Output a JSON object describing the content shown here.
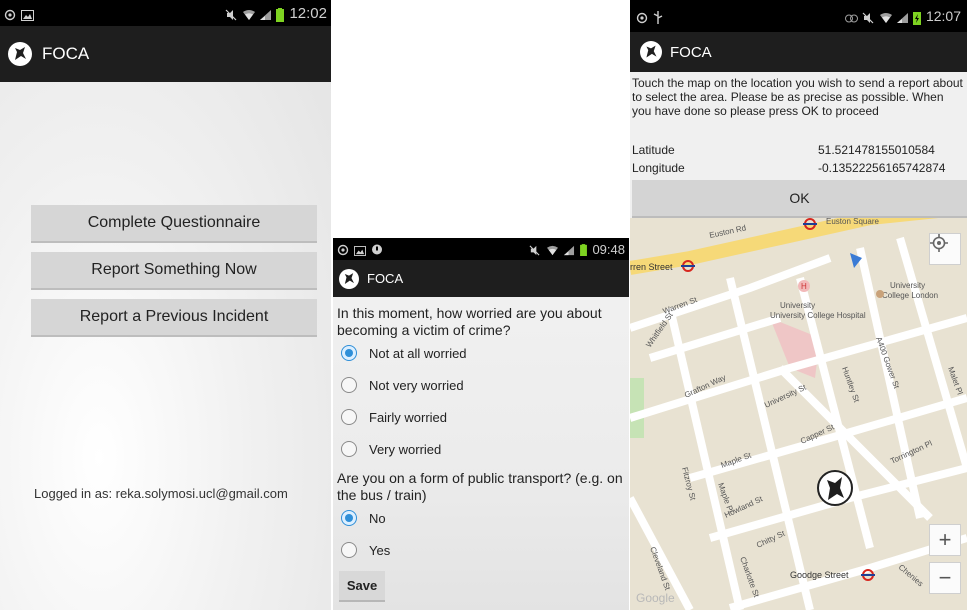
{
  "screen1": {
    "status_time": "12:02",
    "app_title": "FOCA",
    "menu": [
      "Complete Questionnaire",
      "Report Something Now",
      "Report a Previous Incident"
    ],
    "logged_in": "Logged in as: reka.solymosi.ucl@gmail.com"
  },
  "screen2": {
    "status_time": "09:48",
    "app_title": "FOCA",
    "q1": "In this moment, how worried are you about becoming a victim of crime?",
    "q1_options": [
      "Not at all worried",
      "Not very worried",
      "Fairly worried",
      "Very worried"
    ],
    "q1_selected": 0,
    "q2": "Are you on a form of public transport? (e.g. on the bus / train)",
    "q2_options": [
      "No",
      "Yes"
    ],
    "q2_selected": 0,
    "save_label": "Save"
  },
  "screen3": {
    "status_time": "12:07",
    "app_title": "FOCA",
    "instructions": "Touch the map on the location you wish to send a report about to select the area. Please be as precise as possible. When you have done so please press OK to proceed",
    "latitude_label": "Latitude",
    "latitude_value": "51.521478155010584",
    "longitude_label": "Longitude",
    "longitude_value": "-0.13522256165742874",
    "ok_label": "OK",
    "map_labels": {
      "euston_rd": "Euston Rd",
      "euston_square": "Euston Square",
      "warren_street": "rren Street",
      "warren_st": "Warren St",
      "whitfield_st": "Whitfield St",
      "grafton_way": "Grafton Way",
      "uch": "University College Hospital",
      "ucl": "University College London",
      "university_st": "University St",
      "huntley_st": "Huntley St",
      "a400": "A400 Gower St",
      "malet_pl": "Malet Pl",
      "capper_st": "Capper St",
      "maple_st": "Maple St",
      "maple_pl": "Maple Pl",
      "fitzroy_st": "Fitzroy St",
      "howland_st": "Howland St",
      "torrington_pl": "Torrington Pl",
      "chitty_st": "Chitty St",
      "charlotte_st": "Charlotte St",
      "cleveland_st": "Cleveland St",
      "goodge_street": "Goodge Street",
      "chenies": "Chenies",
      "google": "Google"
    },
    "zoom_in": "+",
    "zoom_out": "−"
  },
  "colors": {
    "status_bar": "#000000",
    "action_bar": "#1e1e1e",
    "radio_accent": "#2f8fd8",
    "map_land": "#e8e2d2",
    "map_road": "#ffffff",
    "map_major_road": "#f6d978",
    "map_green": "#c6e3b5",
    "tube_red": "#d7261e"
  }
}
